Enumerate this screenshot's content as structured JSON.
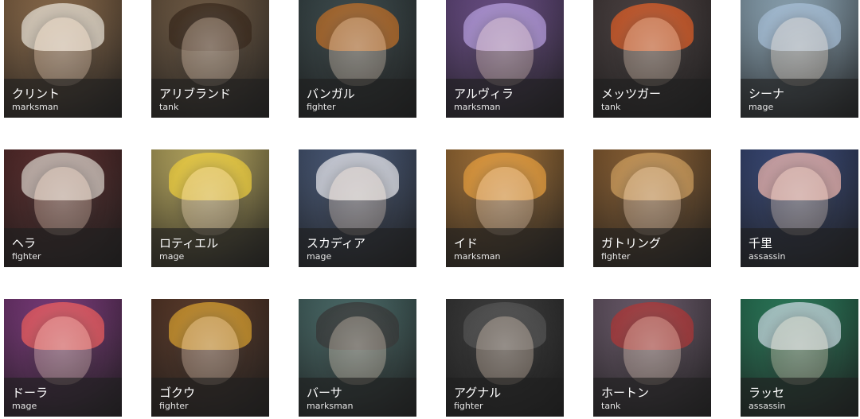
{
  "heroes": [
    {
      "name": "クリント",
      "role": "marksman",
      "bg": "#8a6a4a",
      "hair": "#e8e2d6"
    },
    {
      "name": "アリブランド",
      "role": "tank",
      "bg": "#6f5a44",
      "hair": "#3a2a1e"
    },
    {
      "name": "バンガル",
      "role": "fighter",
      "bg": "#3c4a4c",
      "hair": "#c0702a"
    },
    {
      "name": "アルヴィラ",
      "role": "marksman",
      "bg": "#6a4e86",
      "hair": "#b8a0e0"
    },
    {
      "name": "メッツガー",
      "role": "tank",
      "bg": "#4a4040",
      "hair": "#e0602a"
    },
    {
      "name": "シーナ",
      "role": "mage",
      "bg": "#8fa8b8",
      "hair": "#a8c0d8"
    },
    {
      "name": "ヘラ",
      "role": "fighter",
      "bg": "#5a2e2e",
      "hair": "#d8d0c8"
    },
    {
      "name": "ロティエル",
      "role": "mage",
      "bg": "#b8a860",
      "hair": "#f0d040"
    },
    {
      "name": "スカディア",
      "role": "mage",
      "bg": "#4a5a78",
      "hair": "#e8e8ee"
    },
    {
      "name": "イド",
      "role": "marksman",
      "bg": "#a07038",
      "hair": "#e8a040"
    },
    {
      "name": "ガトリング",
      "role": "fighter",
      "bg": "#8a6034",
      "hair": "#d0a060"
    },
    {
      "name": "千里",
      "role": "assassin",
      "bg": "#3a4a78",
      "hair": "#f0b8b0"
    },
    {
      "name": "ドーラ",
      "role": "mage",
      "bg": "#7a3a7a",
      "hair": "#f06060"
    },
    {
      "name": "ゴクウ",
      "role": "fighter",
      "bg": "#5a3a2a",
      "hair": "#d8a030"
    },
    {
      "name": "バーサ",
      "role": "marksman",
      "bg": "#4a6a68",
      "hair": "#3a3a3a"
    },
    {
      "name": "アグナル",
      "role": "fighter",
      "bg": "#3a3a3a",
      "hair": "#555555"
    },
    {
      "name": "ホートン",
      "role": "tank",
      "bg": "#6a5a6a",
      "hair": "#b03838"
    },
    {
      "name": "ラッセ",
      "role": "assassin",
      "bg": "#2a7a5a",
      "hair": "#c8d8e0"
    }
  ]
}
